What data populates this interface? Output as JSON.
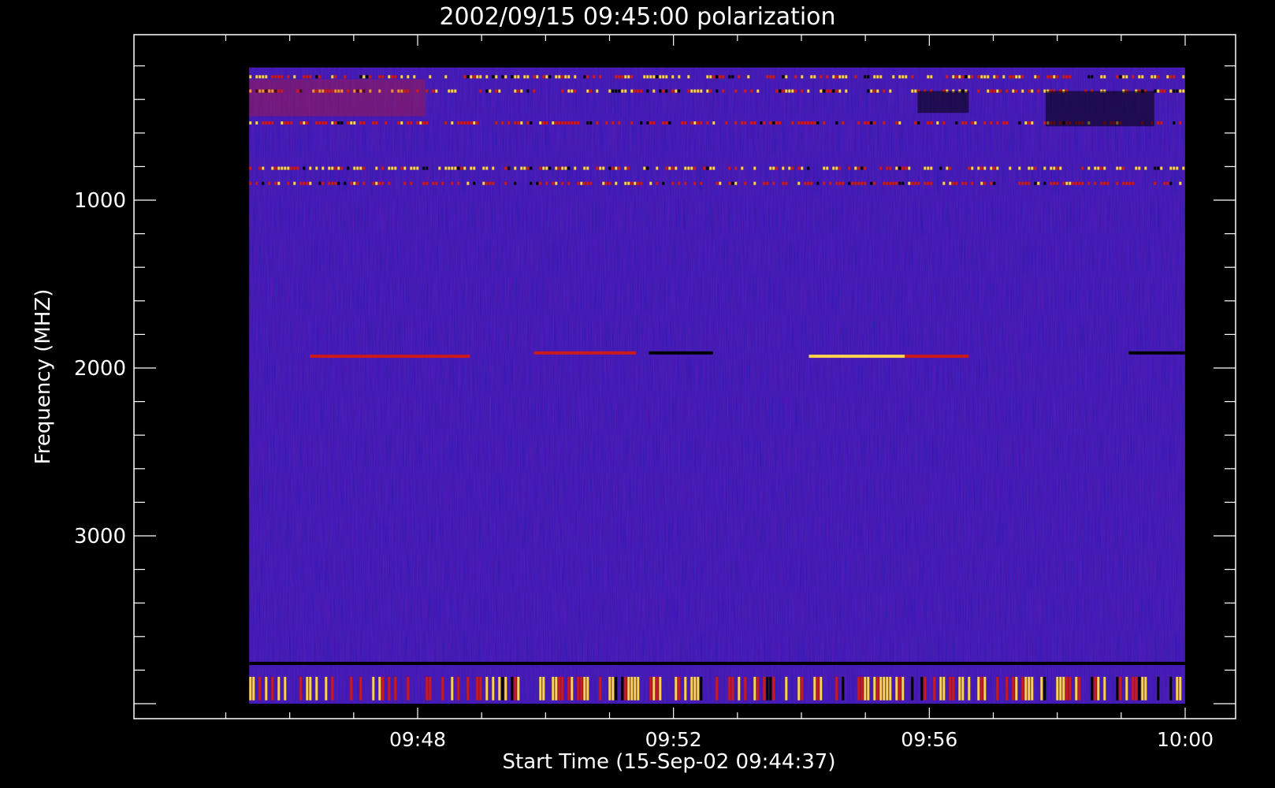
{
  "chart_data": {
    "type": "heatmap",
    "title": "2002/09/15 09:45:00 polarization",
    "xlabel": "Start Time (15-Sep-02 09:44:37)",
    "ylabel": "Frequency (MHZ)",
    "x_tick_labels": [
      "09:48",
      "09:52",
      "09:56",
      "10:00"
    ],
    "y_tick_labels": [
      "1000",
      "2000",
      "3000"
    ],
    "y_ticks": [
      1000,
      2000,
      3000
    ],
    "ylim": [
      4000,
      130
    ],
    "y_inverted": true,
    "x_range_minutes": [
      0,
      15.38
    ],
    "x_major_minutes": [
      3.383,
      7.383,
      11.383,
      15.383
    ],
    "data_time_range_minutes": [
      0.75,
      15.38
    ],
    "data_freq_range_mhz": [
      210,
      4000
    ],
    "colormap": {
      "low": "#000000",
      "background": "#1a12e6",
      "mid": "#cc1a1a",
      "high": "#ffd24d"
    },
    "features": [
      {
        "kind": "band",
        "freq_mhz": 265,
        "t_start": 0.75,
        "t_end": 15.38,
        "value": "high",
        "sparse": true
      },
      {
        "kind": "band",
        "freq_mhz": 350,
        "t_start": 0.75,
        "t_end": 15.38,
        "value": "high",
        "sparse": true
      },
      {
        "kind": "band",
        "freq_mhz": 540,
        "t_start": 0.75,
        "t_end": 15.38,
        "value": "mid",
        "sparse": true
      },
      {
        "kind": "band",
        "freq_mhz": 810,
        "t_start": 0.75,
        "t_end": 15.38,
        "value": "high",
        "sparse": true
      },
      {
        "kind": "band",
        "freq_mhz": 900,
        "t_start": 0.75,
        "t_end": 15.38,
        "value": "mid",
        "sparse": true
      },
      {
        "kind": "band",
        "freq_mhz": 1930,
        "t_start": 1.7,
        "t_end": 4.2,
        "value": "mid"
      },
      {
        "kind": "band",
        "freq_mhz": 1910,
        "t_start": 5.2,
        "t_end": 6.8,
        "value": "mid"
      },
      {
        "kind": "band",
        "freq_mhz": 1910,
        "t_start": 7.0,
        "t_end": 8.0,
        "value": "low"
      },
      {
        "kind": "band",
        "freq_mhz": 1930,
        "t_start": 9.5,
        "t_end": 11.0,
        "value": "high"
      },
      {
        "kind": "band",
        "freq_mhz": 1930,
        "t_start": 11.0,
        "t_end": 12.0,
        "value": "mid"
      },
      {
        "kind": "band",
        "freq_mhz": 1910,
        "t_start": 14.5,
        "t_end": 15.38,
        "value": "low"
      },
      {
        "kind": "patch",
        "freq_mhz": [
          280,
          500
        ],
        "t_start": 0.75,
        "t_end": 3.5,
        "value": "mid"
      },
      {
        "kind": "patch",
        "freq_mhz": [
          350,
          480
        ],
        "t_start": 11.2,
        "t_end": 12.0,
        "value": "low"
      },
      {
        "kind": "patch",
        "freq_mhz": [
          350,
          560
        ],
        "t_start": 13.2,
        "t_end": 14.9,
        "value": "low"
      },
      {
        "kind": "band",
        "freq_mhz": 3760,
        "t_start": 0.75,
        "t_end": 15.38,
        "value": "low"
      },
      {
        "kind": "band",
        "freq_mhz": [
          3840,
          3980
        ],
        "t_start": 0.75,
        "t_end": 15.38,
        "value": "high",
        "sparse": true
      }
    ],
    "grid": false,
    "legend": "none"
  }
}
